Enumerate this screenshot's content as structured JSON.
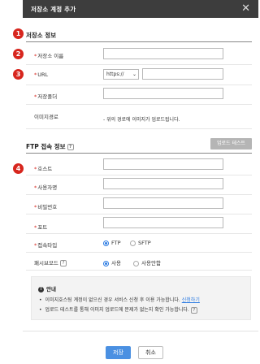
{
  "dialog": {
    "title": "저장소 계정 추가",
    "close_icon": "close-icon"
  },
  "badges": [
    "1",
    "2",
    "3",
    "4"
  ],
  "storage": {
    "section_title": "저장소 정보",
    "name_label": "저장소 이름",
    "url_label": "URL",
    "url_protocol": "https://",
    "folder_label": "저장폴더",
    "image_path_label": "이미지경로",
    "image_path_note": "- 위의 경로에 이미지가 업로드됩니다."
  },
  "ftp": {
    "section_title": "FTP 접속 정보",
    "help": "?",
    "test_button": "업로드 테스트",
    "host_label": "호스트",
    "user_label": "사용자명",
    "password_label": "비밀번호",
    "port_label": "포트",
    "type_label": "접속타입",
    "type_options": [
      "FTP",
      "SFTP"
    ],
    "type_selected": "FTP",
    "passive_label": "패시브모드",
    "passive_options": [
      "사용",
      "사용안함"
    ],
    "passive_selected": "사용"
  },
  "info": {
    "heading": "안내",
    "line1": "이미지호스팅 계정이 없으신 경우 서비스 신청 후 이용 가능합니다.",
    "line1_link": "신청하기",
    "line2": "업로드 테스트를 통해 이미지 업로드에 문제가 없는지 확인 가능합니다."
  },
  "footer": {
    "save": "저장",
    "cancel": "취소"
  },
  "colors": {
    "badge": "#d7261e",
    "primary": "#4a90e2",
    "titlebar": "#3d3d3d"
  }
}
